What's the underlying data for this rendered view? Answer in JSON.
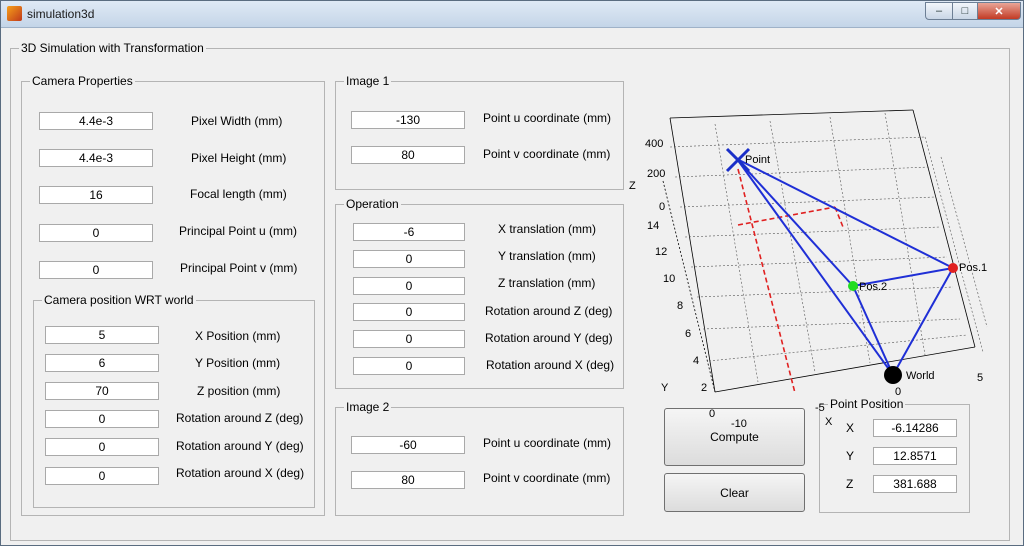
{
  "window": {
    "title": "simulation3d",
    "min_glyph": "–",
    "max_glyph": "□",
    "close_glyph": "✕"
  },
  "main_panel": {
    "title": "3D Simulation with Transformation"
  },
  "camera_properties": {
    "title": "Camera Properties",
    "rows": [
      {
        "value": "4.4e-3",
        "label": "Pixel Width (mm)"
      },
      {
        "value": "4.4e-3",
        "label": "Pixel Height (mm)"
      },
      {
        "value": "16",
        "label": "Focal length (mm)"
      },
      {
        "value": "0",
        "label": "Principal Point u (mm)"
      },
      {
        "value": "0",
        "label": "Principal Point v (mm)"
      }
    ]
  },
  "camera_position": {
    "title": "Camera position WRT world",
    "rows": [
      {
        "value": "5",
        "label": "X Position (mm)"
      },
      {
        "value": "6",
        "label": "Y Position (mm)"
      },
      {
        "value": "70",
        "label": "Z position (mm)"
      },
      {
        "value": "0",
        "label": "Rotation around Z (deg)"
      },
      {
        "value": "0",
        "label": "Rotation around Y (deg)"
      },
      {
        "value": "0",
        "label": "Rotation around X (deg)"
      }
    ]
  },
  "image1": {
    "title": "Image 1",
    "rows": [
      {
        "value": "-130",
        "label": "Point u coordinate (mm)"
      },
      {
        "value": "80",
        "label": "Point v coordinate  (mm)"
      }
    ]
  },
  "operation": {
    "title": "Operation",
    "rows": [
      {
        "value": "-6",
        "label": "X translation (mm)"
      },
      {
        "value": "0",
        "label": "Y translation (mm)"
      },
      {
        "value": "0",
        "label": "Z translation (mm)"
      },
      {
        "value": "0",
        "label": "Rotation around Z (deg)"
      },
      {
        "value": "0",
        "label": "Rotation around Y (deg)"
      },
      {
        "value": "0",
        "label": "Rotation around X (deg)"
      }
    ]
  },
  "image2": {
    "title": "Image 2",
    "rows": [
      {
        "value": "-60",
        "label": "Point u coordinate (mm)"
      },
      {
        "value": "80",
        "label": "Point v coordinate  (mm)"
      }
    ]
  },
  "buttons": {
    "compute": "Compute",
    "clear": "Clear"
  },
  "point_position": {
    "title": "Point Position",
    "rows": [
      {
        "label": "X",
        "value": "-6.14286"
      },
      {
        "label": "Y",
        "value": "12.8571"
      },
      {
        "label": "Z",
        "value": "381.688"
      }
    ]
  },
  "plot": {
    "z_ticks": [
      "400",
      "200",
      "0"
    ],
    "y_ticks": [
      "14",
      "12",
      "10",
      "8",
      "6",
      "4",
      "2",
      "0"
    ],
    "x_ticks": [
      "-10",
      "-5",
      "0",
      "5"
    ],
    "z_label": "Z",
    "y_label": "Y",
    "x_label": "X",
    "point_labels": {
      "point": "Point",
      "pos1": "Pos.1",
      "pos2": "Pos.2",
      "world": "World"
    },
    "colors": {
      "rays": "#1f2fd6",
      "projection": "#e02020",
      "pos1": "#e02020",
      "pos2": "#22dd22",
      "world": "#000000",
      "point": "#1a2fc8"
    }
  }
}
